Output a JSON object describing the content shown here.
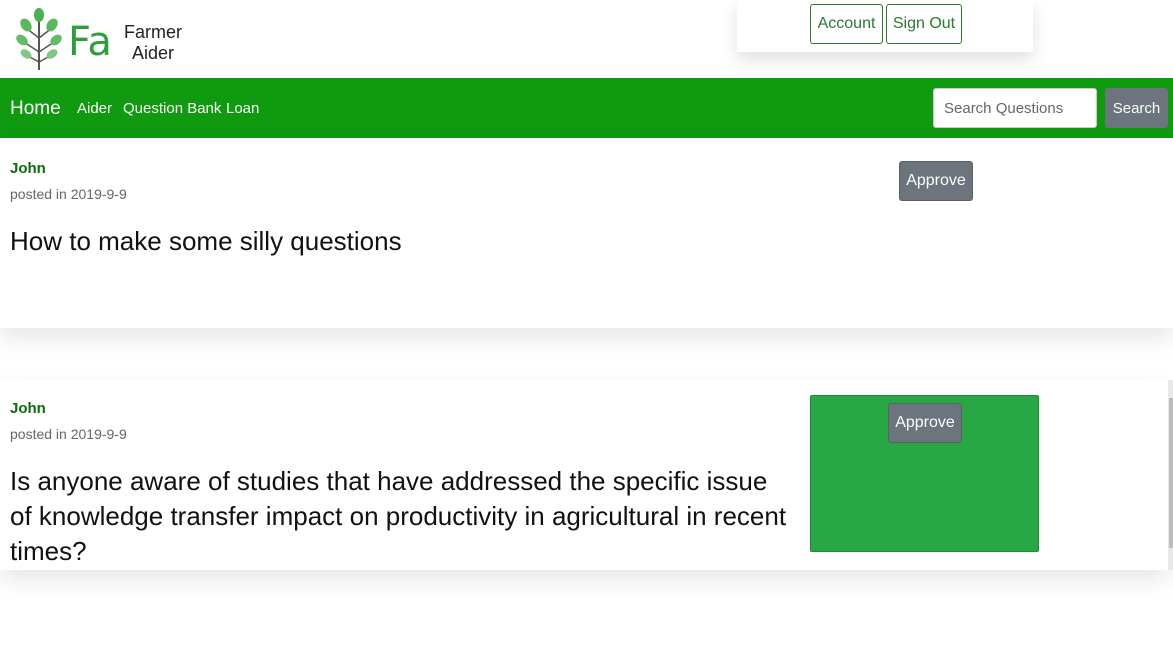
{
  "brand": {
    "short": "Fa",
    "name_line1": "Farmer",
    "name_line2": "Aider",
    "color": "#2f9e3a"
  },
  "account_menu": {
    "account_label": "Account",
    "signout_label": "Sign Out"
  },
  "nav": {
    "home": "Home",
    "links": [
      "Aider",
      "Question Bank",
      "Loan"
    ],
    "search_placeholder": "Search Questions",
    "search_button": "Search",
    "bar_color": "#0f9a0f"
  },
  "questions": [
    {
      "author": "John",
      "posted": "posted in 2019-9-9",
      "title": "How to make some silly questions",
      "approve_label": "Approve"
    },
    {
      "author": "John",
      "posted": "posted in 2019-9-9",
      "title": "Is anyone aware of studies that have addressed the specific issue of knowledge transfer impact on productivity in agricultural in recent times?",
      "approve_label": "Approve"
    }
  ]
}
